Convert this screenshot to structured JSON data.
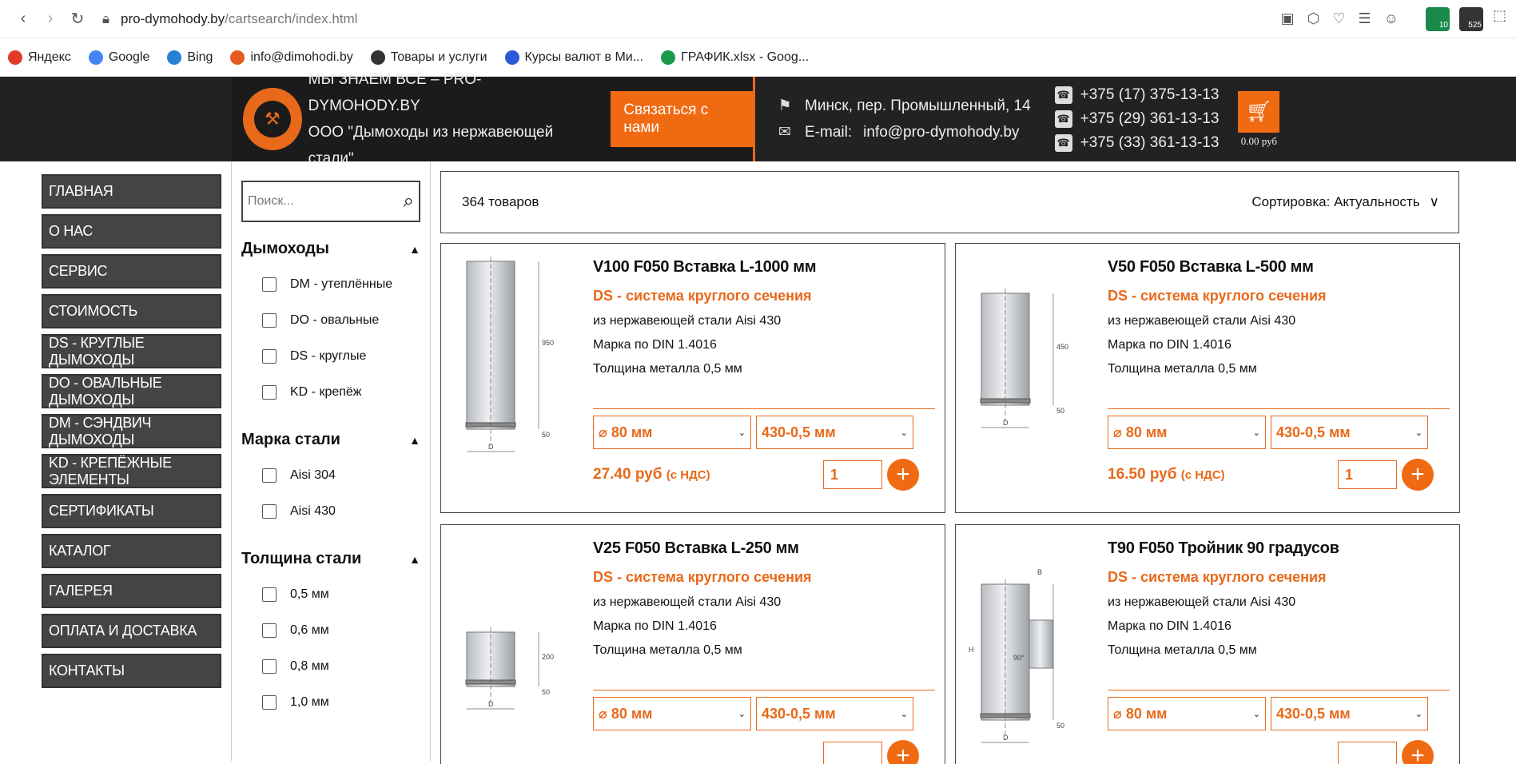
{
  "browser": {
    "url_host": "pro-dymohody.by",
    "url_path": "/cartsearch/index.html",
    "ext_badge_1": "10",
    "ext_badge_2": "525"
  },
  "bookmarks": [
    {
      "label": "Яндекс",
      "icon": "yandex-icon",
      "color": "#e03b2a"
    },
    {
      "label": "Google",
      "icon": "google-icon",
      "color": "#4285f4"
    },
    {
      "label": "Bing",
      "icon": "bing-icon",
      "color": "#2780d8"
    },
    {
      "label": "info@dimohodi.by",
      "icon": "mail-icon",
      "color": "#e35b1e"
    },
    {
      "label": "Товары и услуги",
      "icon": "yandex-services-icon",
      "color": "#333"
    },
    {
      "label": "Курсы валют в Ми...",
      "icon": "currency-icon",
      "color": "#2a5bd7"
    },
    {
      "label": "ГРАФИК.xlsx - Goog...",
      "icon": "sheets-icon",
      "color": "#1a9a4a"
    }
  ],
  "header": {
    "brand_line1": "МЫ ЗНАЕМ ВСЁ   –   PRO-DYMOHODY.BY",
    "brand_line2": "ООО \"Дымоходы из нержавеющей стали\"",
    "contact_button": "Связаться с нами",
    "address": "Минск, пер. Промышленный, 14",
    "email_label": "E-mail:",
    "email": "info@pro-dymohody.by",
    "phones": [
      "+375 (17) 375-13-13",
      "+375 (29) 361-13-13",
      "+375 (33) 361-13-13"
    ],
    "cart_sum": "0.00 руб",
    "accent": "#f06a12"
  },
  "menu": [
    "ГЛАВНАЯ",
    "О НАС",
    "СЕРВИС",
    "СТОИМОСТЬ",
    "DS - КРУГЛЫЕ ДЫМОХОДЫ",
    "DO - ОВАЛЬНЫЕ ДЫМОХОДЫ",
    "DM - СЭНДВИЧ ДЫМОХОДЫ",
    "KD - КРЕПЁЖНЫЕ ЭЛЕМЕНТЫ",
    "СЕРТИФИКАТЫ",
    "КАТАЛОГ",
    "ГАЛЕРЕЯ",
    "ОПЛАТА И ДОСТАВКА",
    "КОНТАКТЫ"
  ],
  "filter": {
    "search_placeholder": "Поиск...",
    "groups": [
      {
        "title": "Дымоходы",
        "options": [
          "DM - утеплённые",
          "DO - овальные",
          "DS - круглые",
          "KD - крепёж"
        ]
      },
      {
        "title": "Марка стали",
        "options": [
          "Aisi 304",
          "Aisi 430"
        ]
      },
      {
        "title": "Толщина стали",
        "options": [
          "0,5 мм",
          "0,6 мм",
          "0,8 мм",
          "1,0 мм"
        ]
      }
    ]
  },
  "toolbar": {
    "count": "364 товаров",
    "sort_label": "Сортировка: Актуальность"
  },
  "products": [
    {
      "title": "V100 F050 Вставка L-1000 мм",
      "subtitle": "DS - система круглого сечения",
      "lines": [
        "из нержавеющей стали Aisi 430",
        "Марка по DIN 1.4016",
        "Толщина металла 0,5 мм"
      ],
      "diameter": "⌀ 80 мм",
      "steel": "430-0,5 мм",
      "price": "27.40 руб",
      "vat": "(с НДС)",
      "qty": "1",
      "dim_h": "950",
      "dim_b": "50",
      "dim_d": "D"
    },
    {
      "title": "V50 F050 Вставка L-500 мм",
      "subtitle": "DS - система круглого сечения",
      "lines": [
        "из нержавеющей стали Aisi 430",
        "Марка по DIN 1.4016",
        "Толщина металла 0,5 мм"
      ],
      "diameter": "⌀ 80 мм",
      "steel": "430-0,5 мм",
      "price": "16.50 руб",
      "vat": "(с НДС)",
      "qty": "1",
      "dim_h": "450",
      "dim_b": "50",
      "dim_d": "D"
    },
    {
      "title": "V25 F050 Вставка L-250 мм",
      "subtitle": "DS - система круглого сечения",
      "lines": [
        "из нержавеющей стали Aisi 430",
        "Марка по DIN 1.4016",
        "Толщина металла 0,5 мм"
      ],
      "diameter": "⌀ 80 мм",
      "steel": "430-0,5 мм",
      "price": "",
      "vat": "",
      "qty": "",
      "dim_h": "200",
      "dim_b": "50",
      "dim_d": "D"
    },
    {
      "title": "T90 F050 Тройник 90 градусов",
      "subtitle": "DS - система круглого сечения",
      "lines": [
        "из нержавеющей стали Aisi 430",
        "Марка по DIN 1.4016",
        "Толщина металла 0,5 мм"
      ],
      "diameter": "⌀ 80 мм",
      "steel": "430-0,5 мм",
      "price": "",
      "vat": "",
      "qty": "",
      "dim_h": "H",
      "dim_b": "50",
      "dim_d": "D",
      "dim_top": "B",
      "dim_angle": "90°"
    }
  ]
}
